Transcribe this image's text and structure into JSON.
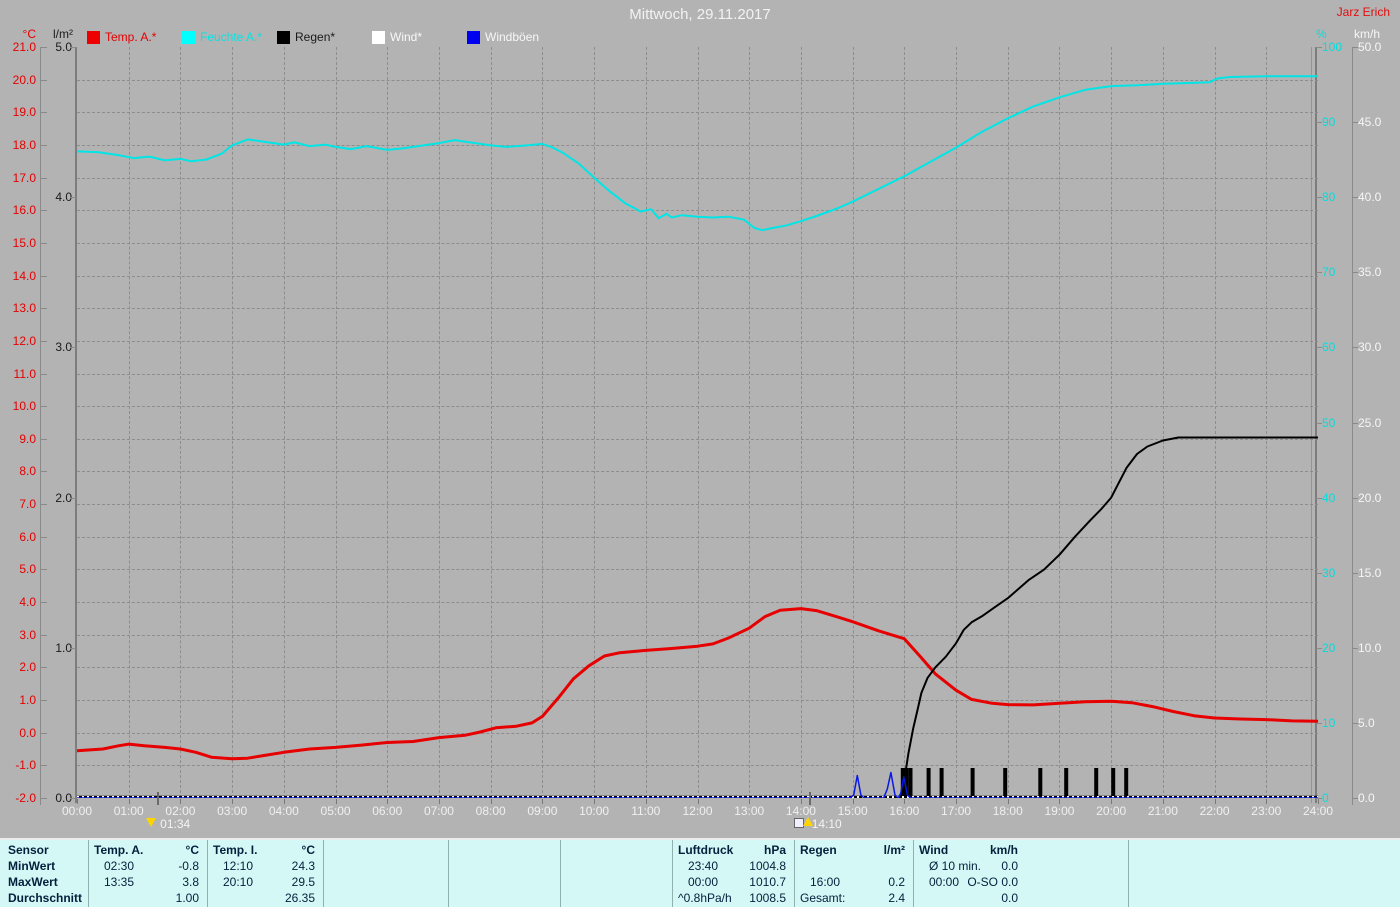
{
  "header": {
    "title": "Mittwoch, 29.11.2017",
    "author": "Jarz Erich"
  },
  "legend": {
    "items": [
      {
        "label": "Temp. A.*",
        "swatch": "#ee0000",
        "text_color": "#e60000"
      },
      {
        "label": "Feuchte A.*",
        "swatch": "#00ffff",
        "text_color": "#00e6e6"
      },
      {
        "label": "Regen*",
        "swatch": "#000000",
        "text_color": "#1a1a1a"
      },
      {
        "label": "Wind*",
        "swatch": "#ffffff",
        "text_color": "#f8f8f8"
      },
      {
        "label": "Windböen",
        "swatch": "#0000f0",
        "text_color": "#f8f8f8"
      }
    ]
  },
  "axes": {
    "temp": {
      "unit": "°C",
      "min": -2,
      "max": 21,
      "step": 1,
      "decimals": 1,
      "color": "#e60000"
    },
    "rain": {
      "unit": "l/m²",
      "min": 0,
      "max": 5,
      "step": 1,
      "decimals": 1,
      "color": "#1a1a1a"
    },
    "humidity": {
      "unit": "%",
      "min": 0,
      "max": 100,
      "step": 10,
      "decimals": 0,
      "color": "#00dede"
    },
    "wind": {
      "unit": "km/h",
      "min": 0,
      "max": 50,
      "step": 5,
      "decimals": 1,
      "color": "#f6f6f6"
    },
    "x": {
      "labels": [
        "00:00",
        "01:00",
        "02:00",
        "03:00",
        "04:00",
        "05:00",
        "06:00",
        "07:00",
        "08:00",
        "09:00",
        "10:00",
        "11:00",
        "12:00",
        "13:00",
        "14:00",
        "15:00",
        "16:00",
        "17:00",
        "18:00",
        "19:00",
        "20:00",
        "21:00",
        "22:00",
        "23:00",
        "24:00"
      ]
    }
  },
  "markers": [
    {
      "label": "01:34",
      "hour": 1.57,
      "icon": "down"
    },
    {
      "label": "14:10",
      "hour": 14.17,
      "icon": "up"
    }
  ],
  "chart_data": {
    "type": "line",
    "title": "Mittwoch, 29.11.2017",
    "x_range": [
      0,
      24
    ],
    "x_unit": "hour",
    "grid": "dashed gray, 1h vertical / 1°C horizontal",
    "legend_position": "top",
    "series": [
      {
        "name": "Temp. A.*",
        "unit": "°C",
        "axis": "temp",
        "color": "#e60000",
        "width": 3,
        "points": [
          [
            0,
            -0.55
          ],
          [
            0.5,
            -0.5
          ],
          [
            0.8,
            -0.4
          ],
          [
            1,
            -0.35
          ],
          [
            1.3,
            -0.4
          ],
          [
            1.7,
            -0.45
          ],
          [
            2,
            -0.5
          ],
          [
            2.3,
            -0.6
          ],
          [
            2.6,
            -0.75
          ],
          [
            3,
            -0.8
          ],
          [
            3.3,
            -0.78
          ],
          [
            3.6,
            -0.7
          ],
          [
            4,
            -0.6
          ],
          [
            4.5,
            -0.5
          ],
          [
            5,
            -0.45
          ],
          [
            5.5,
            -0.38
          ],
          [
            6,
            -0.3
          ],
          [
            6.5,
            -0.27
          ],
          [
            7,
            -0.15
          ],
          [
            7.5,
            -0.08
          ],
          [
            7.8,
            0.02
          ],
          [
            8.1,
            0.15
          ],
          [
            8.5,
            0.2
          ],
          [
            8.8,
            0.3
          ],
          [
            9,
            0.5
          ],
          [
            9.3,
            1.05
          ],
          [
            9.6,
            1.65
          ],
          [
            9.9,
            2.05
          ],
          [
            10.2,
            2.35
          ],
          [
            10.5,
            2.45
          ],
          [
            11,
            2.52
          ],
          [
            11.5,
            2.58
          ],
          [
            12,
            2.65
          ],
          [
            12.3,
            2.72
          ],
          [
            12.6,
            2.9
          ],
          [
            13,
            3.2
          ],
          [
            13.3,
            3.55
          ],
          [
            13.6,
            3.75
          ],
          [
            14,
            3.8
          ],
          [
            14.3,
            3.74
          ],
          [
            14.7,
            3.55
          ],
          [
            15,
            3.4
          ],
          [
            15.5,
            3.12
          ],
          [
            16,
            2.88
          ],
          [
            16.3,
            2.35
          ],
          [
            16.6,
            1.8
          ],
          [
            17,
            1.3
          ],
          [
            17.3,
            1.02
          ],
          [
            17.7,
            0.9
          ],
          [
            18,
            0.86
          ],
          [
            18.5,
            0.85
          ],
          [
            19,
            0.9
          ],
          [
            19.5,
            0.95
          ],
          [
            20,
            0.96
          ],
          [
            20.4,
            0.92
          ],
          [
            20.8,
            0.8
          ],
          [
            21.2,
            0.65
          ],
          [
            21.6,
            0.52
          ],
          [
            22,
            0.45
          ],
          [
            22.5,
            0.42
          ],
          [
            23,
            0.4
          ],
          [
            23.5,
            0.36
          ],
          [
            24,
            0.35
          ]
        ]
      },
      {
        "name": "Feuchte A.*",
        "unit": "%",
        "axis": "humidity",
        "color": "#00e6e6",
        "width": 2,
        "points": [
          [
            0,
            86.1
          ],
          [
            0.4,
            86
          ],
          [
            0.8,
            85.6
          ],
          [
            1.1,
            85.2
          ],
          [
            1.4,
            85.4
          ],
          [
            1.7,
            84.9
          ],
          [
            2,
            85.1
          ],
          [
            2.2,
            84.8
          ],
          [
            2.5,
            85
          ],
          [
            2.8,
            85.8
          ],
          [
            3,
            86.9
          ],
          [
            3.3,
            87.7
          ],
          [
            3.6,
            87.4
          ],
          [
            4,
            87
          ],
          [
            4.2,
            87.3
          ],
          [
            4.5,
            86.8
          ],
          [
            4.8,
            87
          ],
          [
            5,
            86.7
          ],
          [
            5.3,
            86.4
          ],
          [
            5.6,
            86.8
          ],
          [
            6,
            86.3
          ],
          [
            6.3,
            86.5
          ],
          [
            6.7,
            86.9
          ],
          [
            7,
            87.2
          ],
          [
            7.3,
            87.6
          ],
          [
            7.7,
            87.2
          ],
          [
            8,
            86.9
          ],
          [
            8.3,
            86.7
          ],
          [
            8.7,
            86.9
          ],
          [
            9,
            87.1
          ],
          [
            9.2,
            86.6
          ],
          [
            9.4,
            85.9
          ],
          [
            9.7,
            84.5
          ],
          [
            10,
            82.6
          ],
          [
            10.3,
            80.8
          ],
          [
            10.6,
            79.2
          ],
          [
            10.9,
            78.1
          ],
          [
            11.1,
            78.4
          ],
          [
            11.25,
            77.2
          ],
          [
            11.4,
            77.8
          ],
          [
            11.5,
            77.3
          ],
          [
            11.7,
            77.6
          ],
          [
            12,
            77.4
          ],
          [
            12.3,
            77.3
          ],
          [
            12.6,
            77.4
          ],
          [
            12.9,
            77
          ],
          [
            13.1,
            75.9
          ],
          [
            13.25,
            75.6
          ],
          [
            13.45,
            75.9
          ],
          [
            13.7,
            76.2
          ],
          [
            14,
            76.8
          ],
          [
            14.3,
            77.5
          ],
          [
            14.7,
            78.5
          ],
          [
            15,
            79.4
          ],
          [
            15.5,
            81.1
          ],
          [
            16,
            82.8
          ],
          [
            16.5,
            84.7
          ],
          [
            17,
            86.6
          ],
          [
            17.5,
            88.7
          ],
          [
            18,
            90.5
          ],
          [
            18.5,
            92.1
          ],
          [
            19,
            93.3
          ],
          [
            19.5,
            94.3
          ],
          [
            20,
            94.8
          ],
          [
            20.5,
            94.9
          ],
          [
            21,
            95.1
          ],
          [
            21.5,
            95.2
          ],
          [
            21.9,
            95.3
          ],
          [
            22.05,
            95.8
          ],
          [
            22.3,
            96
          ],
          [
            23,
            96.1
          ],
          [
            24,
            96.1
          ]
        ]
      },
      {
        "name": "Regen* (Summe)",
        "unit": "l/m²",
        "axis": "rain",
        "color": "#000000",
        "width": 2,
        "points": [
          [
            0,
            0
          ],
          [
            15.9,
            0
          ],
          [
            15.95,
            0.02
          ],
          [
            16,
            0.12
          ],
          [
            16.08,
            0.3
          ],
          [
            16.17,
            0.46
          ],
          [
            16.25,
            0.58
          ],
          [
            16.33,
            0.7
          ],
          [
            16.45,
            0.8
          ],
          [
            16.6,
            0.87
          ],
          [
            16.8,
            0.94
          ],
          [
            17,
            1.03
          ],
          [
            17.15,
            1.12
          ],
          [
            17.3,
            1.17
          ],
          [
            17.5,
            1.21
          ],
          [
            17.75,
            1.27
          ],
          [
            18,
            1.33
          ],
          [
            18.2,
            1.39
          ],
          [
            18.4,
            1.45
          ],
          [
            18.7,
            1.52
          ],
          [
            19,
            1.62
          ],
          [
            19.3,
            1.74
          ],
          [
            19.6,
            1.85
          ],
          [
            19.8,
            1.92
          ],
          [
            20,
            2.0
          ],
          [
            20.15,
            2.1
          ],
          [
            20.3,
            2.2
          ],
          [
            20.5,
            2.29
          ],
          [
            20.7,
            2.34
          ],
          [
            21,
            2.38
          ],
          [
            21.3,
            2.4
          ],
          [
            22,
            2.4
          ],
          [
            24,
            2.4
          ]
        ]
      },
      {
        "name": "Wind*",
        "unit": "km/h",
        "axis": "wind",
        "color": "#ffffff",
        "width": 2,
        "dash": "2 3",
        "points": [
          [
            0,
            0
          ],
          [
            24,
            0
          ]
        ]
      },
      {
        "name": "Windböen",
        "unit": "km/h",
        "axis": "wind",
        "color": "#0a18e6",
        "width": 1.5,
        "points": [
          [
            0,
            0
          ],
          [
            14.95,
            0
          ],
          [
            15.02,
            0.2
          ],
          [
            15.09,
            1.5
          ],
          [
            15.16,
            0.2
          ],
          [
            15.22,
            0
          ],
          [
            15.6,
            0
          ],
          [
            15.67,
            0.6
          ],
          [
            15.74,
            1.7
          ],
          [
            15.82,
            0.2
          ],
          [
            15.88,
            0
          ],
          [
            15.93,
            0.3
          ],
          [
            15.99,
            1.4
          ],
          [
            16.06,
            0.2
          ],
          [
            16.12,
            0
          ],
          [
            24,
            0
          ]
        ]
      }
    ],
    "rain_events": {
      "color": "#000000",
      "interval_value_lm2": 0.2,
      "hours": [
        15.97,
        16.04,
        16.12,
        16.47,
        16.72,
        17.32,
        17.95,
        18.63,
        19.13,
        19.71,
        20.04,
        20.29
      ]
    }
  },
  "stats_table": {
    "row_headers": [
      "Sensor",
      "MinWert",
      "MaxWert",
      "Durchschnitt"
    ],
    "sections": [
      {
        "title": "Temp. A.",
        "unit": "°C",
        "rows": [
          [
            "02:30",
            "-0.8"
          ],
          [
            "13:35",
            "3.8"
          ],
          [
            "",
            "1.00"
          ]
        ]
      },
      {
        "title": "Temp. I.",
        "unit": "°C",
        "rows": [
          [
            "12:10",
            "24.3"
          ],
          [
            "20:10",
            "29.5"
          ],
          [
            "",
            "26.35"
          ]
        ]
      },
      {
        "title": "Luftdruck",
        "unit": "hPa",
        "rows": [
          [
            "23:40",
            "1004.8"
          ],
          [
            "00:00",
            "1010.7"
          ],
          [
            "^0.8hPa/h",
            "1008.5"
          ]
        ]
      },
      {
        "title": "Regen",
        "unit": "l/m²",
        "rows": [
          [
            "",
            ""
          ],
          [
            "16:00",
            "0.2"
          ],
          [
            "Gesamt:",
            "2.4"
          ]
        ]
      },
      {
        "title": "Wind",
        "unit": "km/h",
        "rows": [
          [
            "Ø 10 min.",
            "0.0"
          ],
          [
            "00:00",
            "O-SO 0.0"
          ],
          [
            "",
            "0.0"
          ]
        ]
      }
    ]
  },
  "colors": {
    "page_bg": "#b3b3b3",
    "grid": "#8d8d8d",
    "border": "#7d7d7d",
    "axis_line": "#8a8a8a",
    "x_axis": "#000000",
    "table_bg": "#d4f8f6",
    "table_text": "#04203c",
    "table_divider": "#8fb2b0",
    "marker_yellow": "#ffd400"
  }
}
